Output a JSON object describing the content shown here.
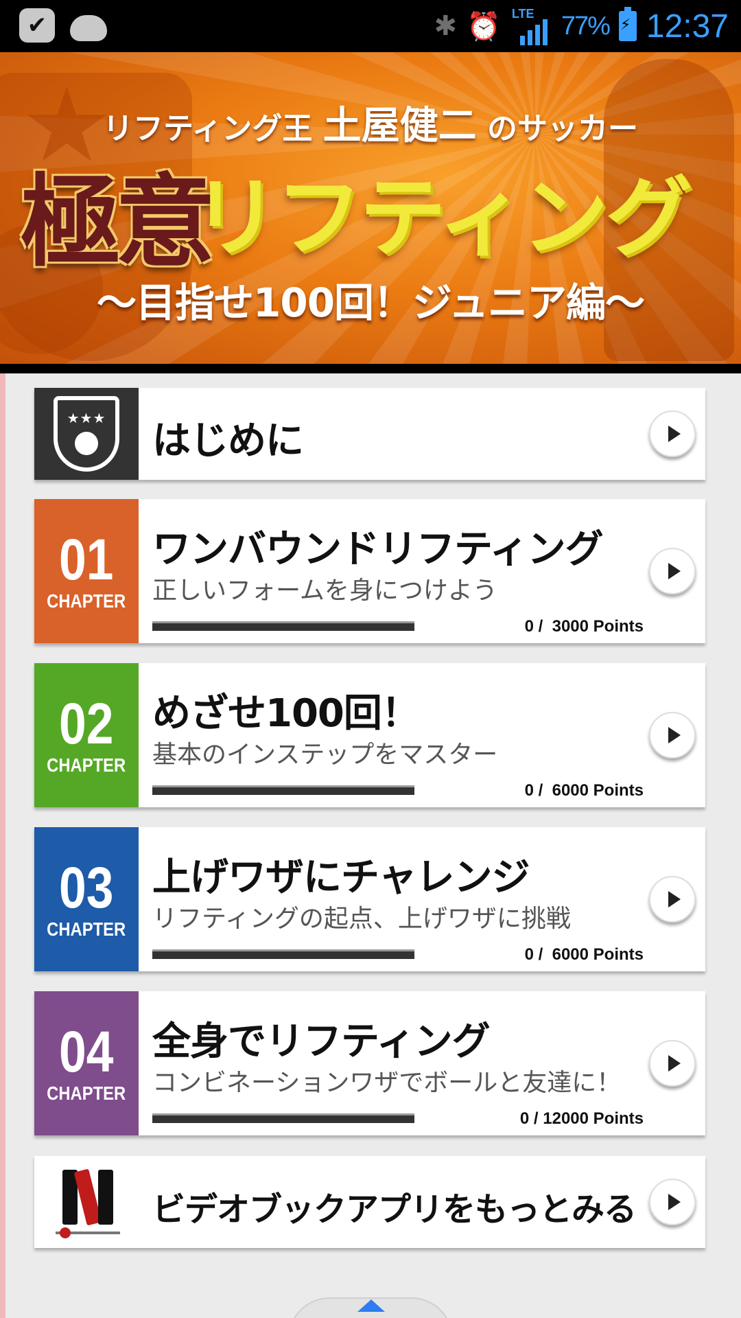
{
  "status_bar": {
    "battery": "77%",
    "time": "12:37",
    "network": "LTE"
  },
  "banner": {
    "subtitle_prefix": "リフティング王 ",
    "subtitle_name": "土屋健二",
    "subtitle_suffix": " のサッカー",
    "title_kanji": "極意",
    "title_katakana": "リフティング",
    "subtitle_bottom": "〜目指せ100回！ジュニア編〜"
  },
  "intro": {
    "title": "はじめに"
  },
  "chapters": [
    {
      "number": "01",
      "label": "CHAPTER",
      "color": "#d9612a",
      "title": "ワンバウンドリフティング",
      "desc": "正しいフォームを身につけよう",
      "points": "0 /  3000 Points",
      "progress": 0
    },
    {
      "number": "02",
      "label": "CHAPTER",
      "color": "#55a826",
      "title": "めざせ100回！",
      "desc": "基本のインステップをマスター",
      "points": "0 /  6000 Points",
      "progress": 0
    },
    {
      "number": "03",
      "label": "CHAPTER",
      "color": "#1e5ba8",
      "title": "上げワザにチャレンジ",
      "desc": "リフティングの起点、上げワザに挑戦",
      "points": "0 /  6000 Points",
      "progress": 0
    },
    {
      "number": "04",
      "label": "CHAPTER",
      "color": "#7f4c8c",
      "title": "全身でリフティング",
      "desc": "コンビネーションワザでボールと友達に！",
      "points": "0 / 12000 Points",
      "progress": 0
    }
  ],
  "more_apps": {
    "title": "ビデオブックアプリをもっとみる"
  }
}
